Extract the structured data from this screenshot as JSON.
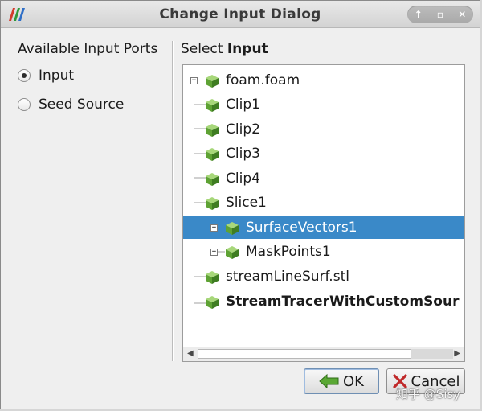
{
  "window": {
    "title": "Change Input Dialog",
    "controls": [
      "up",
      "maximize",
      "close"
    ]
  },
  "left": {
    "heading": "Available Input Ports",
    "ports": [
      {
        "label": "Input",
        "checked": true
      },
      {
        "label": "Seed Source",
        "checked": false
      }
    ]
  },
  "right": {
    "heading_prefix": "Select ",
    "heading_bold": "Input",
    "tree": [
      {
        "label": "foam.foam",
        "level": 0,
        "expander": "minus",
        "selected": false,
        "bold": false
      },
      {
        "label": "Clip1",
        "level": 1,
        "selected": false,
        "bold": false
      },
      {
        "label": "Clip2",
        "level": 1,
        "selected": false,
        "bold": false
      },
      {
        "label": "Clip3",
        "level": 1,
        "selected": false,
        "bold": false
      },
      {
        "label": "Clip4",
        "level": 1,
        "selected": false,
        "bold": false
      },
      {
        "label": "Slice1",
        "level": 1,
        "selected": false,
        "bold": false
      },
      {
        "label": "SurfaceVectors1",
        "level": 2,
        "expander": "plus",
        "selected": true,
        "bold": false
      },
      {
        "label": "MaskPoints1",
        "level": 2,
        "expander": "plus",
        "selected": false,
        "bold": false
      },
      {
        "label": "streamLineSurf.stl",
        "level": 1,
        "selected": false,
        "bold": false
      },
      {
        "label": "StreamTracerWithCustomSour",
        "level": 1,
        "selected": false,
        "bold": true
      }
    ]
  },
  "buttons": {
    "ok": "OK",
    "cancel": "Cancel"
  },
  "watermark": "知乎 @Sisy",
  "colors": {
    "selection": "#3a89c8",
    "cube_green": "#6fb13f"
  }
}
